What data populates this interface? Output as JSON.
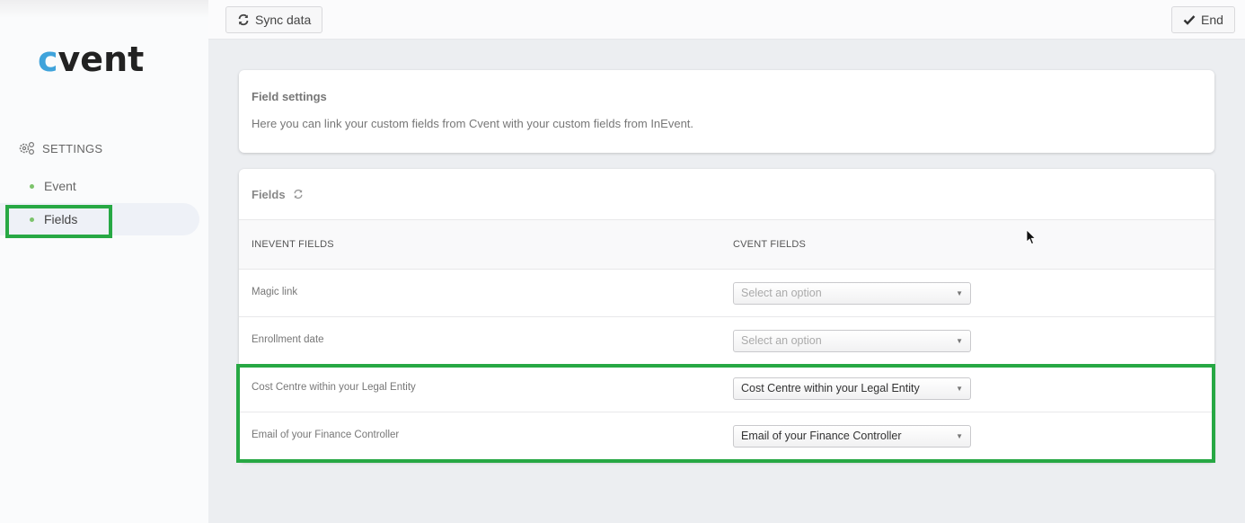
{
  "brand": {
    "logo_c": "c",
    "logo_rest": "vent",
    "accent": "#3fa3db",
    "highlight": "#27a844"
  },
  "sidebar": {
    "section_title": "SETTINGS",
    "section_icon": "gears-icon",
    "items": [
      {
        "label": "Event",
        "active": false
      },
      {
        "label": "Fields",
        "active": true
      }
    ]
  },
  "toolbar": {
    "sync_label": "Sync data",
    "end_label": "End"
  },
  "field_settings": {
    "title": "Field settings",
    "description": "Here you can link your custom fields from Cvent with your custom fields from InEvent."
  },
  "fields": {
    "title": "Fields",
    "columns": [
      "INEVENT FIELDS",
      "CVENT FIELDS"
    ],
    "rows": [
      {
        "inevent": "Magic link",
        "cvent": "Select an option",
        "placeholder": true
      },
      {
        "inevent": "Enrollment date",
        "cvent": "Select an option",
        "placeholder": true
      },
      {
        "inevent": "Cost Centre within your Legal Entity",
        "cvent": "Cost Centre within your Legal Entity",
        "placeholder": false
      },
      {
        "inevent": "Email of your Finance Controller",
        "cvent": "Email of your Finance Controller",
        "placeholder": false
      }
    ]
  }
}
